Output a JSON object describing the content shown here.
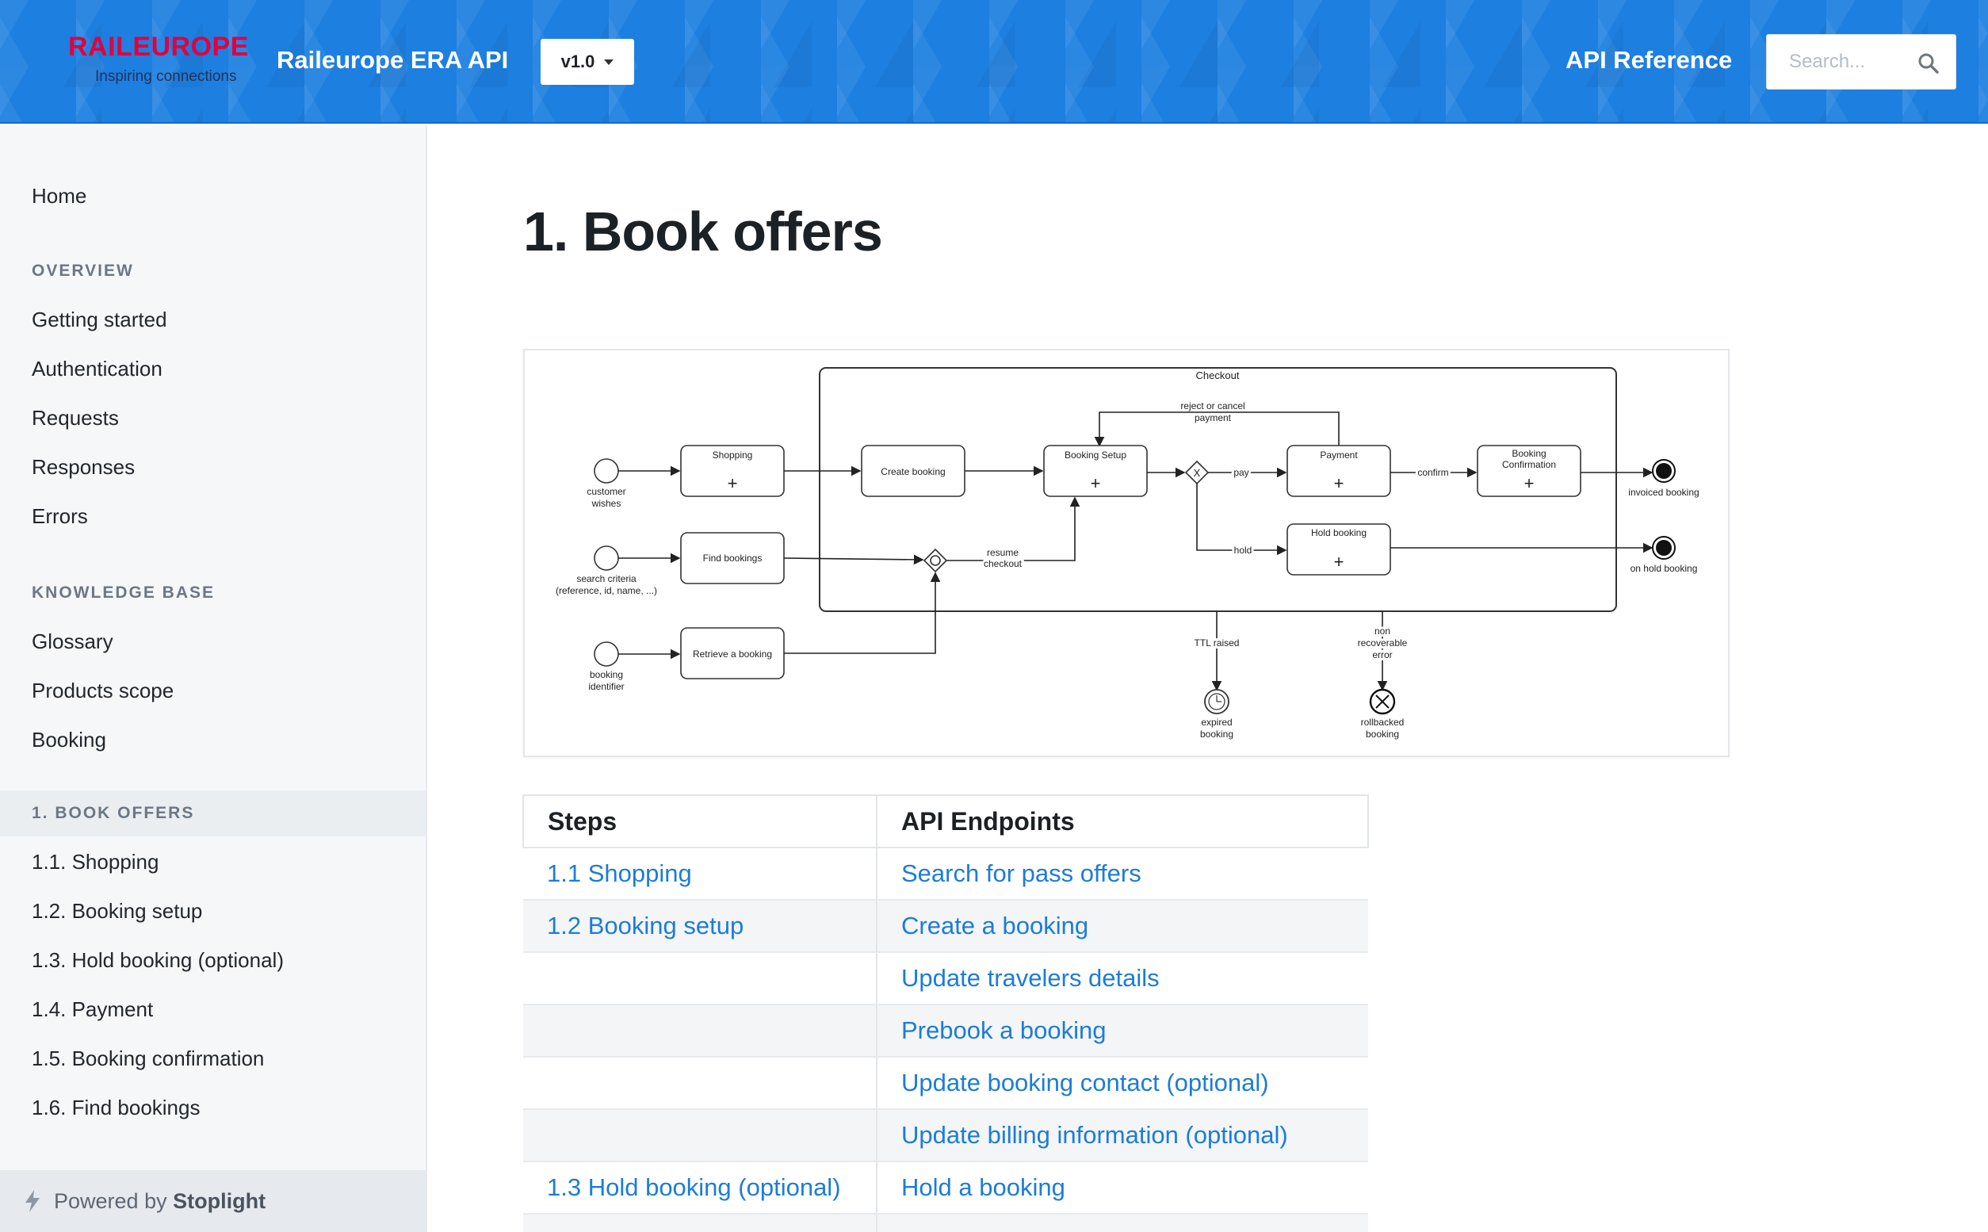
{
  "header": {
    "logo_word": "RAILEUROPE",
    "logo_tagline": "Inspiring connections",
    "app_title": "Raileurope ERA API",
    "version": "v1.0",
    "api_reference": "API Reference",
    "search_placeholder": "Search...",
    "brand_color": "#1d7fe0",
    "logo_color": "#e2003f"
  },
  "sidebar": {
    "home": "Home",
    "overview_title": "OVERVIEW",
    "overview_items": [
      "Getting started",
      "Authentication",
      "Requests",
      "Responses",
      "Errors"
    ],
    "kb_title": "KNOWLEDGE BASE",
    "kb_items": [
      "Glossary",
      "Products scope",
      "Booking"
    ],
    "active_section": "1. BOOK OFFERS",
    "active_items": [
      "1.1. Shopping",
      "1.2. Booking setup",
      "1.3. Hold booking (optional)",
      "1.4. Payment",
      "1.5. Booking confirmation",
      "1.6. Find bookings"
    ],
    "powered_prefix": "Powered by",
    "powered_brand": "Stoplight"
  },
  "main": {
    "title": "1. Book offers"
  },
  "diagram": {
    "checkout": "Checkout",
    "reject_cancel_1": "reject or cancel",
    "reject_cancel_2": "payment",
    "shopping": "Shopping",
    "create_booking": "Create booking",
    "booking_setup": "Booking Setup",
    "payment": "Payment",
    "booking_conf_1": "Booking",
    "booking_conf_2": "Confirmation",
    "find_bookings": "Find bookings",
    "hold_booking": "Hold booking",
    "retrieve_booking": "Retrieve a booking",
    "pay": "pay",
    "confirm": "confirm",
    "hold": "hold",
    "resume_1": "resume",
    "resume_2": "checkout",
    "customer_wishes_1": "customer",
    "customer_wishes_2": "wishes",
    "search_criteria_1": "search criteria",
    "search_criteria_2": "(reference, id, name, ...)",
    "booking_identifier_1": "booking",
    "booking_identifier_2": "identifier",
    "invoiced": "invoiced booking",
    "on_hold": "on hold booking",
    "ttl_raised": "TTL raised",
    "non_recoverable_1": "non",
    "non_recoverable_2": "recoverable",
    "non_recoverable_3": "error",
    "expired_1": "expired",
    "expired_2": "booking",
    "rollbacked_1": "rollbacked",
    "rollbacked_2": "booking"
  },
  "table": {
    "headers": [
      "Steps",
      "API Endpoints"
    ],
    "rows": [
      {
        "step": "1.1 Shopping",
        "endpoint": "Search for pass offers"
      },
      {
        "step": "1.2 Booking setup",
        "endpoint": "Create a booking"
      },
      {
        "step": "",
        "endpoint": "Update travelers details"
      },
      {
        "step": "",
        "endpoint": "Prebook a booking"
      },
      {
        "step": "",
        "endpoint": "Update booking contact (optional)"
      },
      {
        "step": "",
        "endpoint": "Update billing information (optional)"
      },
      {
        "step": "1.3 Hold booking (optional)",
        "endpoint": "Hold a booking"
      }
    ]
  }
}
